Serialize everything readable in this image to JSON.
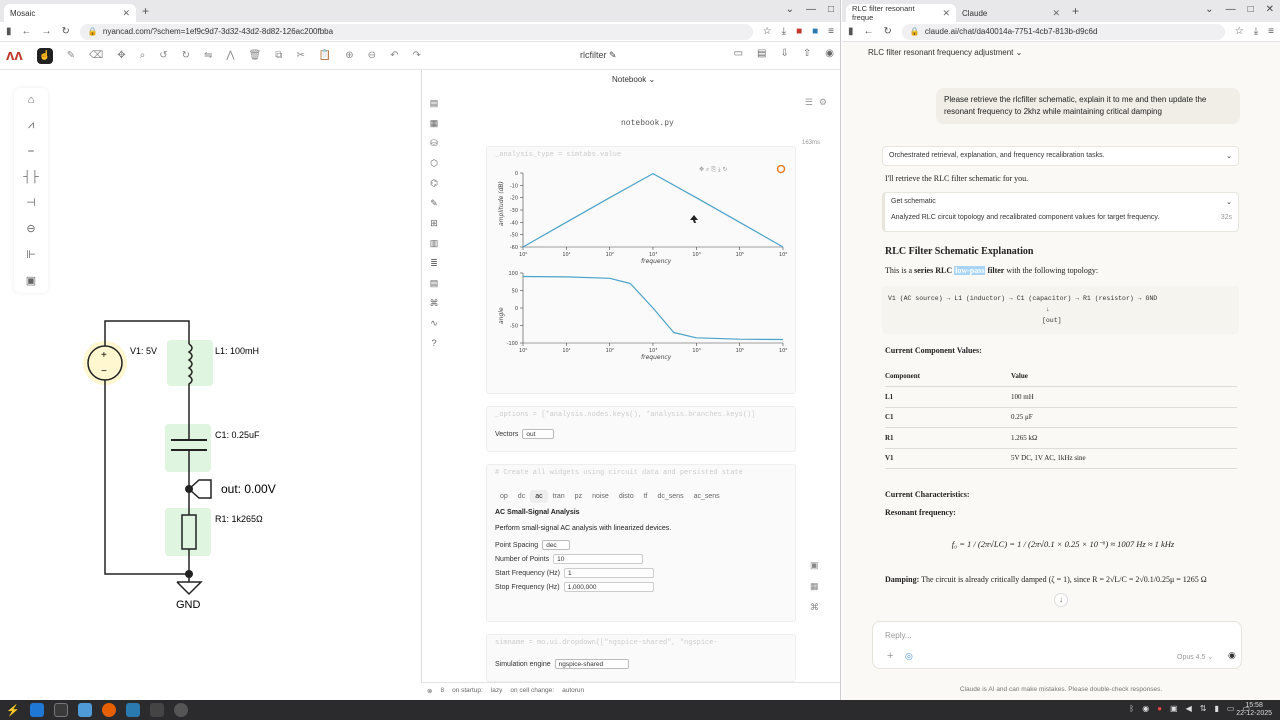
{
  "left_browser": {
    "tab_title": "Mosaic",
    "url": "nyancad.com/?schem=1ef9c9d7-3d32-43d2-8d82-126ac200fbba",
    "app_title": "rlcfilter ✎",
    "notebook_label": "Notebook ⌄",
    "notebook_file": "notebook.py",
    "cell_time": "163ms",
    "cell_analysis_code": "_analysis_type = simtabs.value",
    "cell_options_code": "_options = [*analysis.nodes.keys(), *analysis.branches.keys()]",
    "cell_widgets_code": "# Create all widgets using circuit data and persisted state",
    "cell_sim_code": "simname = mo.ui.dropdown([\"ngspice-shared\", \"ngspice-",
    "vectors_label": "Vectors",
    "vectors_value": "out",
    "sim_tabs": [
      "op",
      "dc",
      "ac",
      "tran",
      "pz",
      "noise",
      "disto",
      "tf",
      "dc_sens",
      "ac_sens"
    ],
    "active_sim_tab": "ac",
    "analysis_title": "AC Small-Signal Analysis",
    "analysis_desc": "Perform small-signal AC analysis with linearized devices.",
    "point_spacing_label": "Point Spacing",
    "point_spacing_value": "dec",
    "num_points_label": "Number of Points",
    "num_points_value": "10",
    "start_freq_label": "Start Frequency (Hz)",
    "start_freq_value": "1",
    "stop_freq_label": "Stop Frequency (Hz)",
    "stop_freq_value": "1,000,000",
    "sim_engine_label": "Simulation engine",
    "sim_engine_value": "ngspice-shared",
    "status_count": "8",
    "status_startup": "on startup:",
    "status_lazy": "lazy",
    "status_cellchange": "on cell change:",
    "status_autorun": "autorun"
  },
  "schematic": {
    "v1": "V1: 5V",
    "l1": "L1: 100mH",
    "c1": "C1: 0.25uF",
    "out": "out: 0.00V",
    "r1": "R1: 1k265Ω",
    "gnd": "GND"
  },
  "chart_data": [
    {
      "type": "line",
      "xlabel": "frequency",
      "ylabel": "amplitude (dB)",
      "x_log": true,
      "x": [
        1,
        10,
        100,
        1000,
        10000,
        100000,
        1000000
      ],
      "y": [
        -60,
        -40,
        -20,
        -0.5,
        -20,
        -40,
        -60
      ],
      "xticks": [
        "10⁰",
        "10¹",
        "10²",
        "10³",
        "10⁴",
        "10⁵",
        "10⁶"
      ],
      "yticks": [
        "0",
        "-10",
        "-20",
        "-30",
        "-40",
        "-50",
        "-60"
      ],
      "ylim": [
        -60,
        0
      ],
      "color": "#4aa3c8"
    },
    {
      "type": "line",
      "xlabel": "frequency",
      "ylabel": "angle",
      "x_log": true,
      "x": [
        1,
        10,
        100,
        300,
        1000,
        3000,
        10000,
        100000,
        1000000
      ],
      "y": [
        90,
        89,
        85,
        70,
        0,
        -70,
        -85,
        -89,
        -90
      ],
      "xticks": [
        "10⁰",
        "10¹",
        "10²",
        "10³",
        "10⁴",
        "10⁵",
        "10⁶"
      ],
      "yticks": [
        "100",
        "50",
        "0",
        "-50",
        "-100"
      ],
      "ylim": [
        -100,
        100
      ],
      "color": "#4aa3c8"
    }
  ],
  "right_browser": {
    "tab1_title": "RLC filter resonant freque",
    "tab2_title": "Claude",
    "url": "claude.ai/chat/da40014a-7751-4cb7-813b-d9c6d",
    "conv_title": "RLC filter resonant frequency adjustment ⌄",
    "user_msg": "Please retrieve the rlcfilter schematic, explain it to me and then update the resonant frequency to 2khz while maintaining critical damping",
    "orchestrated": "Orchestrated retrieval, explanation, and frequency recalibration tasks.",
    "retrieve": "I'll retrieve the RLC filter schematic for you.",
    "get_schematic": "Get schematic",
    "analyzed": "Analyzed RLC circuit topology and recalibrated component values for target frequency.",
    "analyzed_time": "32s",
    "heading": "RLC Filter Schematic Explanation",
    "intro_a": "This is a ",
    "intro_b": "series RLC",
    "intro_c": "low-pass",
    "intro_d": " filter",
    "intro_e": " with the following topology:",
    "code_line1": "V1 (AC source) → L1 (inductor) → C1 (capacitor) → R1 (resistor) → GND",
    "code_line2": "↓",
    "code_line3": "[out]",
    "values_heading": "Current Component Values:",
    "col_component": "Component",
    "col_value": "Value",
    "rows": [
      {
        "c": "L1",
        "v": "100 mH"
      },
      {
        "c": "C1",
        "v": "0.25 μF"
      },
      {
        "c": "R1",
        "v": "1.265 kΩ"
      },
      {
        "c": "V1",
        "v": "5V DC, 1V AC, 1kHz sine"
      }
    ],
    "char_heading": "Current Characteristics:",
    "resonant_label": "Resonant frequency:",
    "formula": "f₀ = 1 / (2π√LC) = 1 / (2π√0.1 × 0.25 × 10⁻⁶) ≈ 1007 Hz ≈ 1 kHz",
    "damping_bold": "Damping:",
    "damping_text": " The circuit is already critically damped (ζ = 1), since R = 2√L/C = 2√0.1/0.25μ = 1265 Ω",
    "reply_placeholder": "Reply...",
    "model": "Opus 4.5 ⌄",
    "disclaimer": "Claude is AI and can make mistakes. Please double-check responses."
  },
  "taskbar": {
    "time": "15:58",
    "date": "22-12-2025"
  }
}
